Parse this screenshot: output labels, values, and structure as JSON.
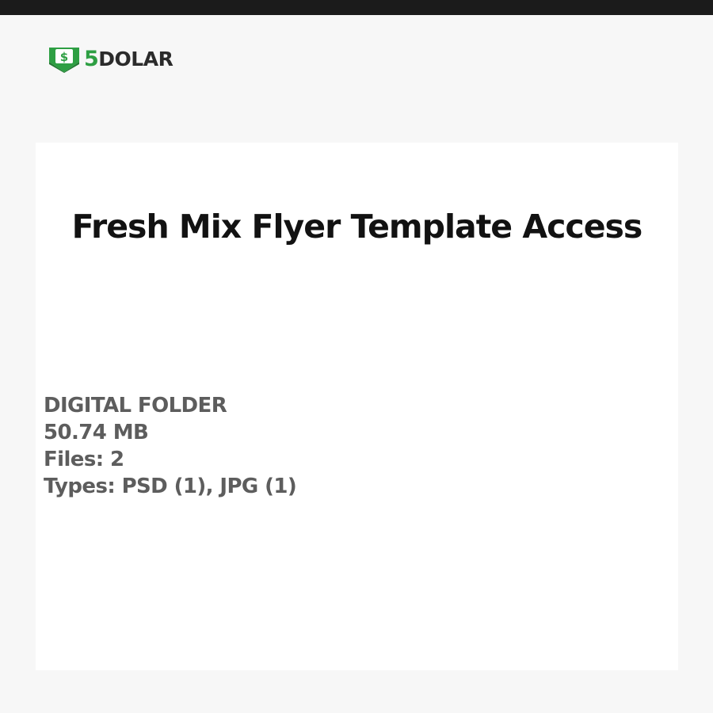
{
  "brand": {
    "icon": "dollar-download-badge-icon",
    "badge_symbol": "$",
    "accent_color": "#2e9f43",
    "logo_five": "5",
    "logo_text": "DOLAR"
  },
  "product": {
    "title": "Fresh Mix Flyer Template Access",
    "folder_label": "DIGITAL FOLDER",
    "size": "50.74 MB",
    "files": "Files: 2",
    "types": "Types: PSD (1), JPG (1)"
  }
}
